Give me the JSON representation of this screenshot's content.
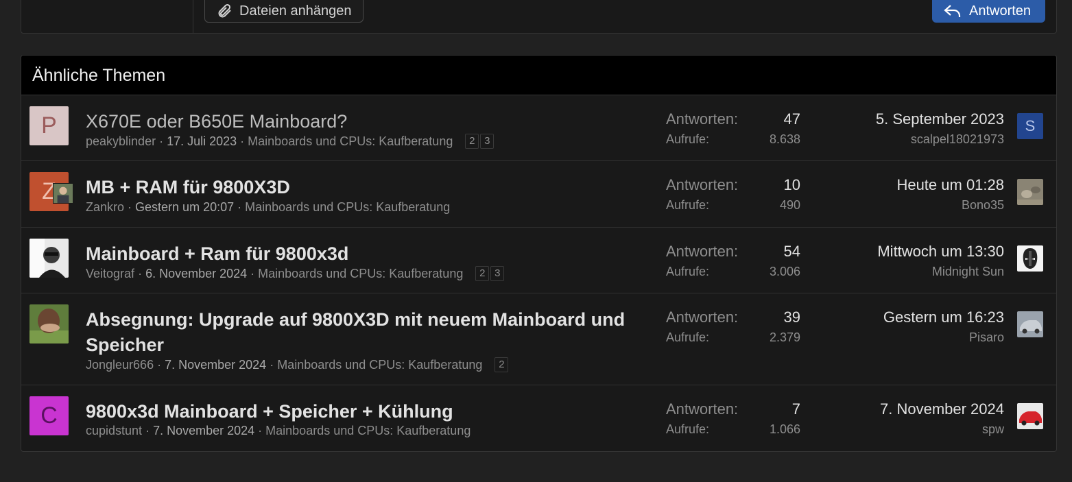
{
  "editor": {
    "attach_label": "Dateien anhängen",
    "reply_label": "Antworten"
  },
  "similar": {
    "header": "Ähnliche Themen",
    "threads": [
      {
        "title": "X670E oder B650E Mainboard?",
        "author": "peakyblinder",
        "date": "17. Juli 2023",
        "forum": "Mainboards und CPUs: Kaufberatung",
        "pages": [
          "2",
          "3"
        ],
        "avatar_letter": "P",
        "replies_label": "Antworten:",
        "replies": "47",
        "views_label": "Aufrufe:",
        "views": "8.638",
        "last_date": "5. September 2023",
        "last_user": "scalpel18021973",
        "last_avatar_letter": "S"
      },
      {
        "title": "MB + RAM für 9800X3D",
        "author": "Zankro",
        "date": "Gestern um 20:07",
        "forum": "Mainboards und CPUs: Kaufberatung",
        "pages": [],
        "avatar_letter": "Z",
        "replies_label": "Antworten:",
        "replies": "10",
        "views_label": "Aufrufe:",
        "views": "490",
        "last_date": "Heute um 01:28",
        "last_user": "Bono35"
      },
      {
        "title": "Mainboard + Ram für 9800x3d",
        "author": "Veitograf",
        "date": "6. November 2024",
        "forum": "Mainboards und CPUs: Kaufberatung",
        "pages": [
          "2",
          "3"
        ],
        "replies_label": "Antworten:",
        "replies": "54",
        "views_label": "Aufrufe:",
        "views": "3.006",
        "last_date": "Mittwoch um 13:30",
        "last_user": "Midnight Sun"
      },
      {
        "title": "Absegnung: Upgrade auf 9800X3D mit neuem Mainboard und Speicher",
        "author": "Jongleur666",
        "date": "7. November 2024",
        "forum": "Mainboards und CPUs: Kaufberatung",
        "pages": [
          "2"
        ],
        "replies_label": "Antworten:",
        "replies": "39",
        "views_label": "Aufrufe:",
        "views": "2.379",
        "last_date": "Gestern um 16:23",
        "last_user": "Pisaro"
      },
      {
        "title": "9800x3d Mainboard + Speicher + Kühlung",
        "author": "cupidstunt",
        "date": "7. November 2024",
        "forum": "Mainboards und CPUs: Kaufberatung",
        "pages": [],
        "avatar_letter": "C",
        "replies_label": "Antworten:",
        "replies": "7",
        "views_label": "Aufrufe:",
        "views": "1.066",
        "last_date": "7. November 2024",
        "last_user": "spw"
      }
    ]
  },
  "colors": {
    "accent": "#2c5ca8",
    "avatar_p": "#d9c6c6",
    "avatar_z": "#c0502f",
    "avatar_c": "#c934d1",
    "avatar_s": "#22458f"
  }
}
